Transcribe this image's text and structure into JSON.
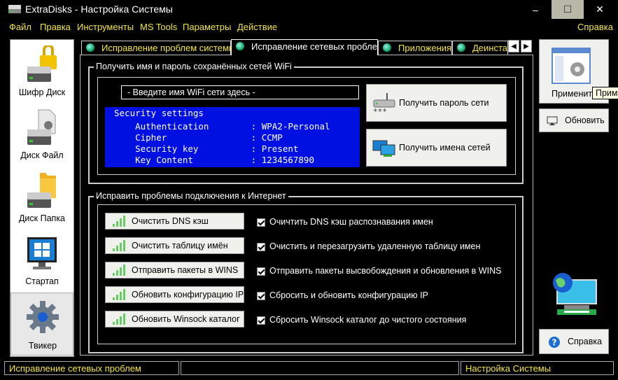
{
  "window": {
    "title": "ExtraDisks - Настройка Системы",
    "minimize": "–",
    "maximize": "☐",
    "close": "✕"
  },
  "menu": {
    "items": [
      "Файл",
      "Правка",
      "Инструменты",
      "MS Tools",
      "Параметры",
      "Действие"
    ],
    "help": "Справка"
  },
  "sidebar": {
    "items": [
      {
        "label": "Шифр Диск",
        "icon": "lock-disk-icon"
      },
      {
        "label": "Диск Файл",
        "icon": "file-disk-icon"
      },
      {
        "label": "Диск Папка",
        "icon": "folder-disk-icon"
      },
      {
        "label": "Стартап",
        "icon": "startup-window-icon"
      },
      {
        "label": "Твикер",
        "icon": "gear-icon"
      }
    ]
  },
  "tabs": [
    {
      "label": "Исправление проблем системы"
    },
    {
      "label": "Исправление сетевых проблем"
    },
    {
      "label": "Приложения"
    },
    {
      "label": "Деинсталлятор"
    }
  ],
  "wifi_group": {
    "title": "Получить имя и пароль сохранённых сетей WiFi",
    "input_value": "- Введите имя WiFi сети здесь -",
    "console_lines": [
      "Security settings",
      "    Authentication        : WPA2-Personal",
      "    Cipher                : CCMP",
      "    Security key          : Present",
      "    Key Content           : 1234567890"
    ],
    "btn_password": "Получить пароль сети",
    "btn_names": "Получить имена сетей"
  },
  "internet_group": {
    "title": "Исправить проблемы подключения к Интернет",
    "rows": [
      {
        "button": "Очистить DNS кэш",
        "check": "Очичтить DNS кэш распознавания имен",
        "checked": true
      },
      {
        "button": "Очистить таблицу имён",
        "check": "Очистить и перезагрузить удаленную таблицу имен",
        "checked": true
      },
      {
        "button": "Отправить пакеты в WINS",
        "check": "Отправить пакеты высвобождения и обновления в WINS",
        "checked": true
      },
      {
        "button": "Обновить конфигурацию IP",
        "check": "Сбросить и обновить конфигурацию IP",
        "checked": true
      },
      {
        "button": "Обновить Winsock каталог",
        "check": "Сбросить Winsock каталог до чистого состояния",
        "checked": true
      }
    ]
  },
  "right": {
    "apply": "Применить",
    "tooltip": "Приме",
    "refresh": "Обновить",
    "help": "Справка"
  },
  "status": {
    "left": "Исправление сетевых проблем",
    "middle": "",
    "right": "Настройка Системы"
  }
}
